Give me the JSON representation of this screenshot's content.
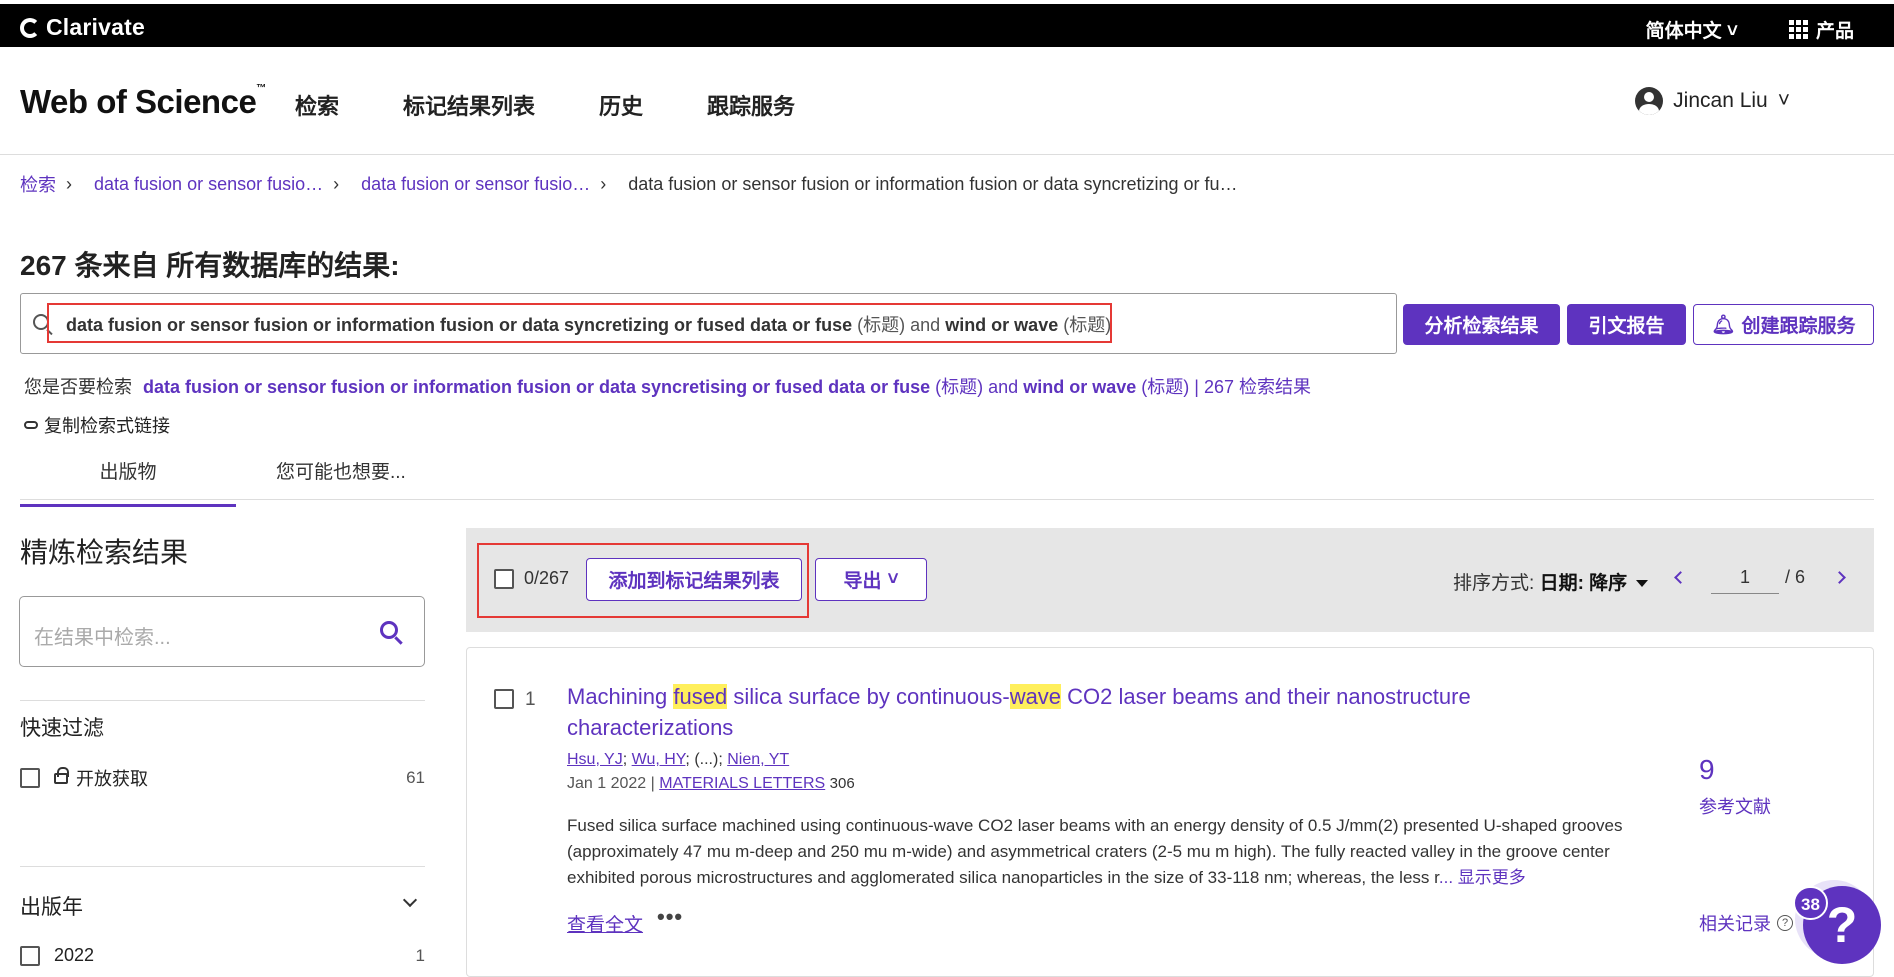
{
  "topbar": {
    "logo": "Clarivate",
    "language": "简体中文",
    "products": "产品"
  },
  "header": {
    "brand": "Web of Science",
    "brand_tm": "™",
    "nav": [
      "检索",
      "标记结果列表",
      "历史",
      "跟踪服务"
    ],
    "user": "Jincan Liu"
  },
  "breadcrumb": {
    "items": [
      "检索",
      "data fusion or sensor fusio…",
      "data fusion or sensor fusio…"
    ],
    "current": "data fusion or sensor fusion or information fusion or data syncretizing or fu…"
  },
  "results": {
    "title": "267 条来自 所有数据库的结果:",
    "query": {
      "term1": "data fusion or sensor fusion or information fusion or data syncretizing or fused data or fuse",
      "field1": "(标题)",
      "op": "and",
      "term2": "wind or wave",
      "field2": "(标题)"
    },
    "buttons": {
      "analyze": "分析检索结果",
      "citation_report": "引文报告",
      "create_alert": "创建跟踪服务"
    },
    "did_you_mean": {
      "label": "您是否要检索",
      "term1": "data fusion or sensor fusion or information fusion or data syncretising or fused data or fuse",
      "field1": "(标题)",
      "op": "and",
      "term2": "wind or wave",
      "field2": "(标题)",
      "count": "| 267 检索结果"
    },
    "copy_link": "复制检索式链接",
    "tabs": [
      "出版物",
      "您可能也想要..."
    ]
  },
  "refine": {
    "title": "精炼检索结果",
    "search_placeholder": "在结果中检索...",
    "quick_filter": {
      "heading": "快速过滤",
      "items": [
        {
          "label": "开放获取",
          "count": "61"
        }
      ]
    },
    "pub_year": {
      "heading": "出版年",
      "items": [
        {
          "label": "2022",
          "count": "1"
        }
      ]
    }
  },
  "toolbar": {
    "selected": "0/267",
    "add_to_marked": "添加到标记结果列表",
    "export": "导出",
    "sort_label": "排序方式:",
    "sort_value": "日期: 降序",
    "page": "1",
    "total_pages": "/ 6"
  },
  "record": {
    "number": "1",
    "title_parts": [
      "Machining ",
      "fused",
      " silica surface by continuous-",
      "wave",
      " CO2 laser beams and their nanostructure characterizations"
    ],
    "authors": {
      "a1": "Hsu, YJ",
      "a2": "Wu, HY",
      "etc": "(...)",
      "a3": "Nien, YT"
    },
    "date": "Jan 1 2022",
    "journal": "MATERIALS LETTERS",
    "article_no": "306",
    "abstract": "Fused silica surface machined using continuous-wave CO2 laser beams with an energy density of 0.5 J/mm(2) presented U-shaped grooves (approximately 47 mu m-deep and 250 mu m-wide) and asymmetrical craters (2-5 mu m high). The fully reacted valley in the groove center exhibited porous microstructures and agglomerated silica nanoparticles in the size of 33-118 nm; whereas, the less r",
    "show_more": "... 显示更多",
    "full_text": "查看全文",
    "more_options": "•••",
    "references_count": "9",
    "references_label": "参考文献",
    "related_label": "相关记录"
  },
  "help": {
    "badge": "38",
    "icon": "?"
  },
  "colors": {
    "accent": "#5e33bf",
    "highlight": "#ffef5c",
    "annotation": "#e53935"
  }
}
